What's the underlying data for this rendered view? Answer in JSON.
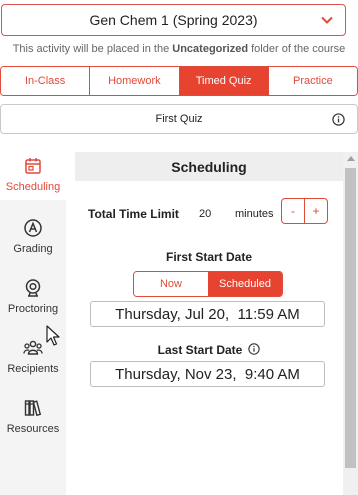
{
  "course": {
    "selected": "Gen Chem 1 (Spring 2023)",
    "icon": "chevron-down-icon"
  },
  "folder_note": {
    "prefix": "This activity will be placed in the",
    "folder": "Uncategorized",
    "suffix": "folder of the course"
  },
  "mode_tabs": [
    {
      "label": "In-Class",
      "active": false
    },
    {
      "label": "Homework",
      "active": false
    },
    {
      "label": "Timed Quiz",
      "active": true
    },
    {
      "label": "Practice",
      "active": false
    }
  ],
  "quiz": {
    "selected": "First Quiz",
    "icon": "info-icon"
  },
  "sidebar": {
    "items": [
      {
        "label": "Scheduling",
        "icon": "calendar-icon",
        "active": true
      },
      {
        "label": "Grading",
        "icon": "grading-icon",
        "active": false
      },
      {
        "label": "Proctoring",
        "icon": "webcam-icon",
        "active": false
      },
      {
        "label": "Recipients",
        "icon": "people-icon",
        "active": false
      },
      {
        "label": "Resources",
        "icon": "books-icon",
        "active": false
      }
    ]
  },
  "panel": {
    "title": "Scheduling",
    "total_time": {
      "label": "Total Time Limit",
      "value": "20",
      "unit": "minutes",
      "decrement": "-",
      "increment": "+"
    },
    "first_start": {
      "label": "First Start Date",
      "options": [
        "Now",
        "Scheduled"
      ],
      "selected": "Scheduled",
      "value": "Thursday, Jul 20,  11:59 AM"
    },
    "last_start": {
      "label": "Last Start Date",
      "icon": "info-icon",
      "value": "Thursday, Nov 23,  9:40 AM"
    }
  },
  "colors": {
    "accent": "#e64331",
    "sidebar_bg": "#f4f4f4",
    "panel_header_bg": "#eeeeee"
  }
}
